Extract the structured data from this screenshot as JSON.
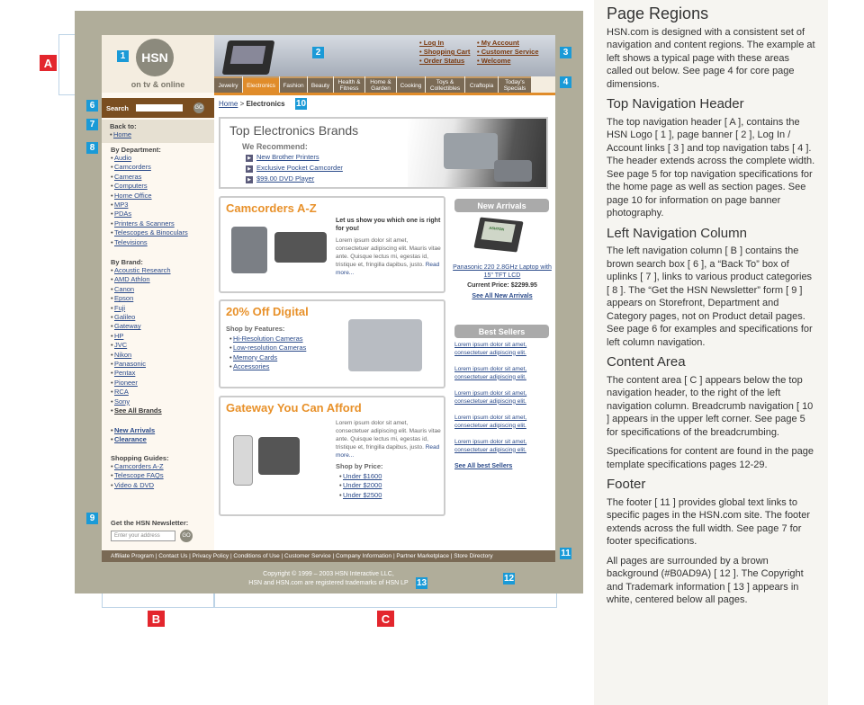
{
  "callouts": {
    "A": "A",
    "B": "B",
    "C": "C",
    "n1": "1",
    "n2": "2",
    "n3": "3",
    "n4": "4",
    "n6": "6",
    "n7": "7",
    "n8": "8",
    "n9": "9",
    "n10": "10",
    "n11": "11",
    "n12": "12",
    "n13": "13"
  },
  "logo": {
    "text": "HSN",
    "sub": "on tv & online"
  },
  "account": [
    "• Log In",
    "• My Account",
    "• Shopping Cart",
    "• Customer Service",
    "• Order Status",
    "• Welcome"
  ],
  "tabs": [
    "Jewelry",
    "Electronics",
    "Fashion",
    "Beauty",
    "Health & Fitness",
    "Home & Garden",
    "Cooking",
    "Toys & Collectibles",
    "Craftopia",
    "Today's Specials"
  ],
  "left": {
    "search_label": "Search",
    "go": "GO",
    "back_title": "Back to:",
    "back_home": "Home",
    "dept_title": "By Department:",
    "dept": [
      "Audio",
      "Camcorders",
      "Cameras",
      "Computers",
      "Home Office",
      "MP3",
      "PDAs",
      "Printers & Scanners",
      "Telescopes & Binoculars",
      "Televisions"
    ],
    "brand_title": "By Brand:",
    "brands": [
      "Acoustic Research",
      "AMD Athlon",
      "Canon",
      "Epson",
      "Fuji",
      "Galileo",
      "Gateway",
      "HP",
      "JVC",
      "Nikon",
      "Panasonic",
      "Pentax",
      "Pioneer",
      "RCA",
      "Sony",
      "See All Brands"
    ],
    "extra": [
      "New Arrivals",
      "Clearance"
    ],
    "guides_title": "Shopping Guides:",
    "guides": [
      "Camcorders A-Z",
      "Telescope FAQs",
      "Video & DVD"
    ],
    "newsletter_title": "Get the HSN Newsletter:",
    "newsletter_placeholder": "Enter your address"
  },
  "breadcrumb": {
    "home": "Home",
    "sep": " > ",
    "current": "Electronics"
  },
  "brands_box": {
    "title": "Top Electronics Brands",
    "sub": "We Recommend:",
    "links": [
      "New Brother Printers",
      "Exclusive Pocket Camcorder",
      "$99.00 DVD Player"
    ]
  },
  "camcorders": {
    "title": "Camcorders A-Z",
    "lead": "Let us show you which one is right for you!",
    "body": "Lorem ipsum dolor sit amet, consectetuer adipiscing elit. Mauris vitae ante. Quisque lectus mi, egestas id, tristique et, fringilla dapibus, justo.",
    "more": "Read more..."
  },
  "digital": {
    "title": "20% Off Digital",
    "sub": "Shop by Features:",
    "links": [
      "Hi-Resolution Cameras",
      "Low-resolution Cameras",
      "Memory Cards",
      "Accessories"
    ]
  },
  "gateway": {
    "title": "Gateway You Can Afford",
    "body": "Lorem ipsum dolor sit amet, consectetuer adipiscing elit. Mauris vitae ante. Quisque lectus mi, egestas id, tristique et, fringilla dapibus, justo.",
    "more": "Read more...",
    "sub": "Shop by Price:",
    "links": [
      "Under $1600",
      "Under $2000",
      "Under $2500"
    ]
  },
  "new_arrivals": {
    "title": "New Arrivals",
    "laptop_brand": "ASHTON",
    "product": "Panasonic 220 2.8GHz Laptop with 15\" TFT LCD",
    "price": "Current Price: $2299.95",
    "see_all": "See All New Arrivals"
  },
  "best_sellers": {
    "title": "Best Sellers",
    "items": [
      "Lorem ipsum dolor sit amet, consectetuer adipiscing elit.",
      "Lorem ipsum dolor sit amet, consectetuer adipiscing elit.",
      "Lorem ipsum dolor sit amet, consectetuer adipiscing elit.",
      "Lorem ipsum dolor sit amet, consectetuer adipiscing elit.",
      "Lorem ipsum dolor sit amet, consectetuer adipiscing elit."
    ],
    "see_all": "See All best Sellers"
  },
  "footer": "Affiliate Program  |  Contact Us  |  Privacy Policy  |  Conditions of Use  |  Customer Service  |  Company Information  |  Partner Marketplace  |  Store Directory",
  "copyright": [
    "Copyright © 1999 – 2003 HSN Interactive LLC,",
    "HSN and HSN.com are registered trademarks of HSN LP"
  ],
  "sidebar": {
    "title": "Page Regions",
    "intro": "HSN.com is designed with a consistent set of navigation and content regions. The example at left shows a typical page with these areas called out below. See page 4 for core page dimensions.",
    "h_top": "Top Navigation Header",
    "p_top": "The top navigation header [ A ],  contains the HSN Logo [ 1 ], page banner [ 2 ], Log In / Account links [ 3 ] and top navigation tabs [ 4 ]. The header extends across the complete width.  See page 5 for top navigation specifications for the home page as well as section pages. See page 10 for information on page banner photography.",
    "h_left": "Left Navigation Column",
    "p_left": "The left navigation column [ B ] contains the brown search box [ 6 ], a “Back To” box of uplinks [ 7 ], links to various product categories [ 8 ]. The “Get the HSN Newsletter” form [ 9 ] appears on Storefront, Department and Category pages, not on Product detail pages. See page 6 for examples and specifications for left column navigation.",
    "h_content": "Content Area",
    "p_content1": "The content area  [ C ] appears below the top navigation header, to the right of the left navigation column. Breadcrumb navigation  [ 10 ] appears in the upper left corner. See page 5 for specifications of the breadcrumbing.",
    "p_content2": "Specifications for content are found in the page template specifications pages 12-29.",
    "h_footer": "Footer",
    "p_footer": "The footer [ 11 ] provides global text links to specific pages in the HSN.com site. The footer extends across the full width.  See page 7 for footer specifications.",
    "p_bg": "All pages are surrounded by a brown background (#B0AD9A) [ 12 ]. The Copyright and Trademark information [ 13 ] appears in white, centered below all pages."
  }
}
